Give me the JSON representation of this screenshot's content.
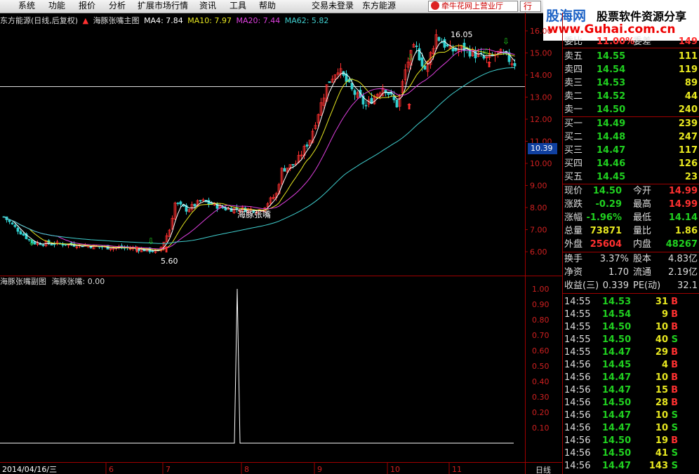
{
  "menu": {
    "items": [
      "系统",
      "功能",
      "报价",
      "分析",
      "扩展市场行情",
      "资讯",
      "工具",
      "帮助",
      "交易未登录",
      "东方能源"
    ],
    "broker_label": "牵牛花网上营业厅",
    "row_label": "行"
  },
  "logo": {
    "brand": "股海网",
    "slogan": "股票软件资源分享",
    "url": "www.Guhai.com.cn"
  },
  "chart": {
    "title": "东方能源(日线,后复权)",
    "indicator_title": "海豚张嘴主图",
    "ma4": "MA4: 7.84",
    "ma10": "MA10: 7.97",
    "ma20": "MA20: 7.44",
    "ma62": "MA62: 5.82",
    "annotation": "海豚张嘴",
    "high_label": "16.05",
    "low_label": "5.60",
    "price_ticks": [
      "16.00",
      "15.00",
      "14.00",
      "13.00",
      "12.00",
      "11.00",
      "10.00",
      "9.00",
      "8.00",
      "7.00",
      "6.00"
    ],
    "crosshair_price": "10.39",
    "sub_title": "海豚张嘴副图",
    "sub_value": "海豚张嘴: 0.00",
    "sub_ticks": [
      "1.00",
      "0.90",
      "0.80",
      "0.70",
      "0.60",
      "0.50",
      "0.40",
      "0.30",
      "0.20",
      "0.10"
    ],
    "date_label": "2014/04/16/三",
    "month_labels": [
      "6",
      "7",
      "8",
      "9",
      "10",
      "11"
    ],
    "period": "日线",
    "colors": {
      "ma4": "#ffffff",
      "ma10": "#e8e820",
      "ma20": "#e040e0",
      "ma62": "#40d0d0",
      "up": "#ff3030",
      "down": "#30d0d0"
    }
  },
  "quote": {
    "header": [
      {
        "label": "委比",
        "value": "11.00%",
        "label2": "委差",
        "value2": "149"
      }
    ],
    "asks": [
      {
        "label": "卖五",
        "price": "14.55",
        "vol": "111"
      },
      {
        "label": "卖四",
        "price": "14.54",
        "vol": "119"
      },
      {
        "label": "卖三",
        "price": "14.53",
        "vol": "89"
      },
      {
        "label": "卖二",
        "price": "14.52",
        "vol": "44"
      },
      {
        "label": "卖一",
        "price": "14.50",
        "vol": "240"
      }
    ],
    "bids": [
      {
        "label": "买一",
        "price": "14.49",
        "vol": "239"
      },
      {
        "label": "买二",
        "price": "14.48",
        "vol": "247"
      },
      {
        "label": "买三",
        "price": "14.47",
        "vol": "117"
      },
      {
        "label": "买四",
        "price": "14.46",
        "vol": "126"
      },
      {
        "label": "买五",
        "price": "14.45",
        "vol": "23"
      }
    ],
    "stats": [
      {
        "l1": "现价",
        "v1": "14.50",
        "l2": "今开",
        "v2": "14.99"
      },
      {
        "l1": "涨跌",
        "v1": "-0.29",
        "l2": "最高",
        "v2": "14.99"
      },
      {
        "l1": "涨幅",
        "v1": "-1.96%",
        "l2": "最低",
        "v2": "14.14"
      },
      {
        "l1": "总量",
        "v1": "73871",
        "l2": "量比",
        "v2": "1.86"
      },
      {
        "l1": "外盘",
        "v1": "25604",
        "l2": "内盘",
        "v2": "48267"
      }
    ],
    "fundamentals": [
      {
        "l1": "换手",
        "v1": "3.37%",
        "l2": "股本",
        "v2": "4.83亿"
      },
      {
        "l1": "净资",
        "v1": "1.70",
        "l2": "流通",
        "v2": "2.19亿"
      },
      {
        "l1": "收益(三)",
        "v1": "0.339",
        "l2": "PE(动)",
        "v2": "32.1"
      }
    ],
    "ticks": [
      {
        "time": "14:55",
        "price": "14.53",
        "vol": "31",
        "side": "B"
      },
      {
        "time": "14:55",
        "price": "14.54",
        "vol": "9",
        "side": "B"
      },
      {
        "time": "14:55",
        "price": "14.50",
        "vol": "10",
        "side": "B"
      },
      {
        "time": "14:55",
        "price": "14.50",
        "vol": "40",
        "side": "S"
      },
      {
        "time": "14:55",
        "price": "14.47",
        "vol": "29",
        "side": "B"
      },
      {
        "time": "14:56",
        "price": "14.45",
        "vol": "4",
        "side": "B"
      },
      {
        "time": "14:56",
        "price": "14.47",
        "vol": "10",
        "side": "B"
      },
      {
        "time": "14:56",
        "price": "14.47",
        "vol": "15",
        "side": "B"
      },
      {
        "time": "14:56",
        "price": "14.50",
        "vol": "28",
        "side": "B"
      },
      {
        "time": "14:56",
        "price": "14.47",
        "vol": "10",
        "side": "S"
      },
      {
        "time": "14:56",
        "price": "14.47",
        "vol": "10",
        "side": "S"
      },
      {
        "time": "14:56",
        "price": "14.50",
        "vol": "19",
        "side": "B"
      },
      {
        "time": "14:56",
        "price": "14.50",
        "vol": "41",
        "side": "S"
      },
      {
        "time": "14:56",
        "price": "14.47",
        "vol": "143",
        "side": "S"
      }
    ]
  }
}
